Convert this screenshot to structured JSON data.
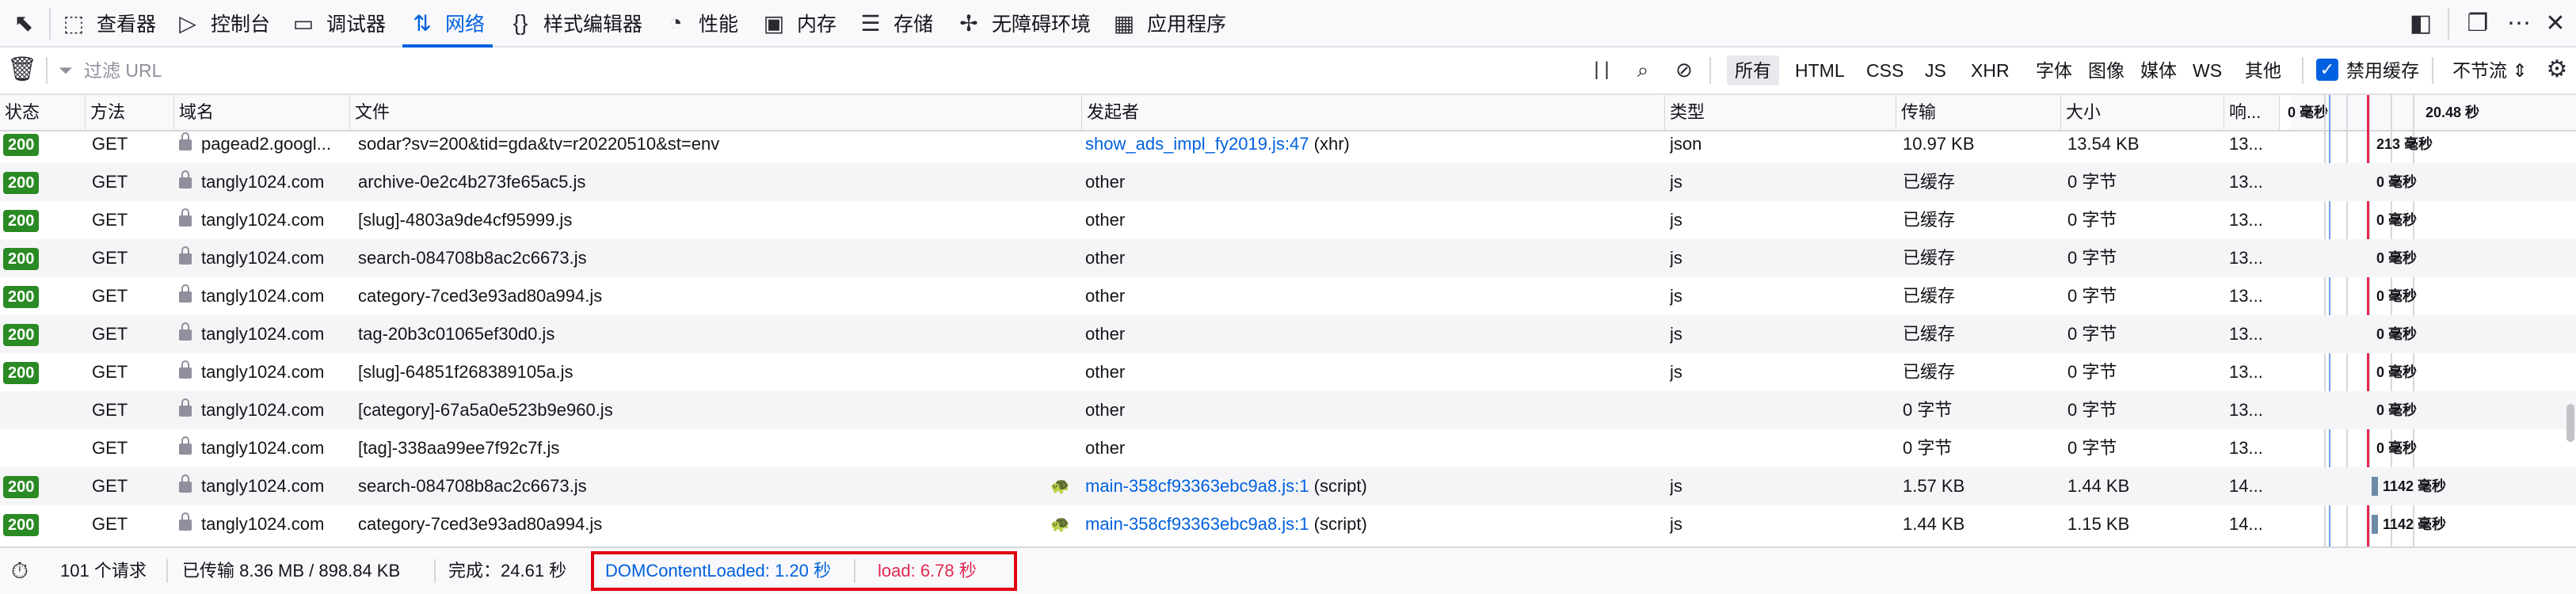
{
  "tabs": [
    {
      "label": "查看器",
      "icon": "inspector-icon"
    },
    {
      "label": "控制台",
      "icon": "console-icon"
    },
    {
      "label": "调试器",
      "icon": "debugger-icon"
    },
    {
      "label": "网络",
      "icon": "network-icon"
    },
    {
      "label": "样式编辑器",
      "icon": "style-editor-icon"
    },
    {
      "label": "性能",
      "icon": "performance-icon"
    },
    {
      "label": "内存",
      "icon": "memory-icon"
    },
    {
      "label": "存储",
      "icon": "storage-icon"
    },
    {
      "label": "无障碍环境",
      "icon": "accessibility-icon"
    },
    {
      "label": "应用程序",
      "icon": "application-icon"
    }
  ],
  "filter": {
    "placeholder": "过滤 URL",
    "types": [
      "所有",
      "HTML",
      "CSS",
      "JS",
      "XHR",
      "字体",
      "图像",
      "媒体",
      "WS",
      "其他"
    ],
    "disable_cache": "禁用缓存",
    "throttle": "不节流 ⇕"
  },
  "columns": [
    "状态",
    "方法",
    "域名",
    "文件",
    "发起者",
    "类型",
    "传输",
    "大小",
    "响...",
    "0 毫秒",
    "20.48 秒"
  ],
  "rows": [
    {
      "status": "200",
      "method": "GET",
      "domain": "pagead2.googl...",
      "file": "sodar?sv=200&tid=gda&tv=r20220510&st=env",
      "initiator": "show_ads_impl_fy2019.js:47",
      "initiator_suffix": " (xhr)",
      "type": "json",
      "transfer": "10.97 KB",
      "size": "13.54 KB",
      "resp": "13...",
      "timing": "213 毫秒",
      "lock": true,
      "tracker": false
    },
    {
      "status": "200",
      "method": "GET",
      "domain": "tangly1024.com",
      "file": "archive-0e2c4b273fe65ac5.js",
      "initiator": "other",
      "initiator_suffix": "",
      "type": "js",
      "transfer": "已缓存",
      "size": "0 字节",
      "resp": "13...",
      "timing": "0 毫秒",
      "lock": true,
      "tracker": false
    },
    {
      "status": "200",
      "method": "GET",
      "domain": "tangly1024.com",
      "file": "[slug]-4803a9de4cf95999.js",
      "initiator": "other",
      "initiator_suffix": "",
      "type": "js",
      "transfer": "已缓存",
      "size": "0 字节",
      "resp": "13...",
      "timing": "0 毫秒",
      "lock": true,
      "tracker": false
    },
    {
      "status": "200",
      "method": "GET",
      "domain": "tangly1024.com",
      "file": "search-084708b8ac2c6673.js",
      "initiator": "other",
      "initiator_suffix": "",
      "type": "js",
      "transfer": "已缓存",
      "size": "0 字节",
      "resp": "13...",
      "timing": "0 毫秒",
      "lock": true,
      "tracker": false
    },
    {
      "status": "200",
      "method": "GET",
      "domain": "tangly1024.com",
      "file": "category-7ced3e93ad80a994.js",
      "initiator": "other",
      "initiator_suffix": "",
      "type": "js",
      "transfer": "已缓存",
      "size": "0 字节",
      "resp": "13...",
      "timing": "0 毫秒",
      "lock": true,
      "tracker": false
    },
    {
      "status": "200",
      "method": "GET",
      "domain": "tangly1024.com",
      "file": "tag-20b3c01065ef30d0.js",
      "initiator": "other",
      "initiator_suffix": "",
      "type": "js",
      "transfer": "已缓存",
      "size": "0 字节",
      "resp": "13...",
      "timing": "0 毫秒",
      "lock": true,
      "tracker": false
    },
    {
      "status": "200",
      "method": "GET",
      "domain": "tangly1024.com",
      "file": "[slug]-64851f268389105a.js",
      "initiator": "other",
      "initiator_suffix": "",
      "type": "js",
      "transfer": "已缓存",
      "size": "0 字节",
      "resp": "13...",
      "timing": "0 毫秒",
      "lock": true,
      "tracker": false
    },
    {
      "status": "",
      "method": "GET",
      "domain": "tangly1024.com",
      "file": "[category]-67a5a0e523b9e960.js",
      "initiator": "other",
      "initiator_suffix": "",
      "type": "",
      "transfer": "0 字节",
      "size": "0 字节",
      "resp": "13...",
      "timing": "0 毫秒",
      "lock": true,
      "tracker": false
    },
    {
      "status": "",
      "method": "GET",
      "domain": "tangly1024.com",
      "file": "[tag]-338aa99ee7f92c7f.js",
      "initiator": "other",
      "initiator_suffix": "",
      "type": "",
      "transfer": "0 字节",
      "size": "0 字节",
      "resp": "13...",
      "timing": "0 毫秒",
      "lock": true,
      "tracker": false
    },
    {
      "status": "200",
      "method": "GET",
      "domain": "tangly1024.com",
      "file": "search-084708b8ac2c6673.js",
      "initiator": "main-358cf93363ebc9a8.js:1",
      "initiator_suffix": " (script)",
      "type": "js",
      "transfer": "1.57 KB",
      "size": "1.44 KB",
      "resp": "14...",
      "timing": "1142 毫秒",
      "lock": true,
      "tracker": true
    },
    {
      "status": "200",
      "method": "GET",
      "domain": "tangly1024.com",
      "file": "category-7ced3e93ad80a994.js",
      "initiator": "main-358cf93363ebc9a8.js:1",
      "initiator_suffix": " (script)",
      "type": "js",
      "transfer": "1.44 KB",
      "size": "1.15 KB",
      "resp": "14...",
      "timing": "1142 毫秒",
      "lock": true,
      "tracker": true
    }
  ],
  "status_bar": {
    "requests": "101 个请求",
    "transferred": "已传输 8.36 MB / 898.84 KB",
    "finish": "完成：24.61 秒",
    "dcl": "DOMContentLoaded: 1.20 秒",
    "load": "load: 6.78 秒"
  },
  "colors": {
    "accent": "#0061e0",
    "status_ok": "#2a8a23",
    "dcl": "#0060df",
    "load": "#e22850",
    "highlight_box": "#e0000f"
  }
}
